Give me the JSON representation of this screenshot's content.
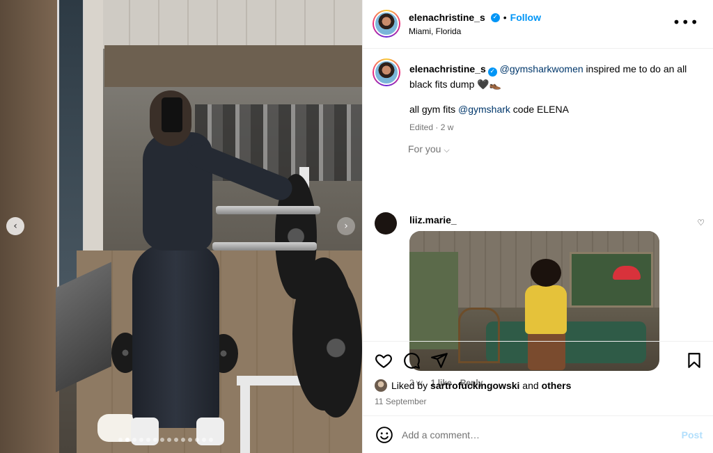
{
  "post": {
    "username": "elenachristine_s",
    "follow_label": "Follow",
    "separator": "•",
    "location": "Miami, Florida",
    "more_label": "•••",
    "caption_user": "elenachristine_s",
    "caption_mention1": "@gymsharkwomen",
    "caption_text1": " inspired me to do an all black fits dump 🖤👞",
    "caption_text2a": "all gym fits ",
    "caption_mention2": "@gymshark",
    "caption_text2b": " code ELENA",
    "caption_meta": "Edited · 2 w",
    "for_you": "For you",
    "slide_count": 14,
    "active_slide": 1
  },
  "comment": {
    "username": "liiz.marie_",
    "time": "2 w",
    "likes": "1 like",
    "reply": "Reply"
  },
  "footer": {
    "liked_by_prefix": "Liked by ",
    "liked_by_user": "sartrofuckingowski",
    "liked_by_and": " and ",
    "liked_by_others": "others",
    "date": "11 September",
    "add_comment_placeholder": "Add a comment…",
    "post_label": "Post"
  },
  "colors": {
    "accent": "#0095f6",
    "mention": "#00376b",
    "muted": "#737373",
    "post_disabled": "#b2dffc"
  }
}
